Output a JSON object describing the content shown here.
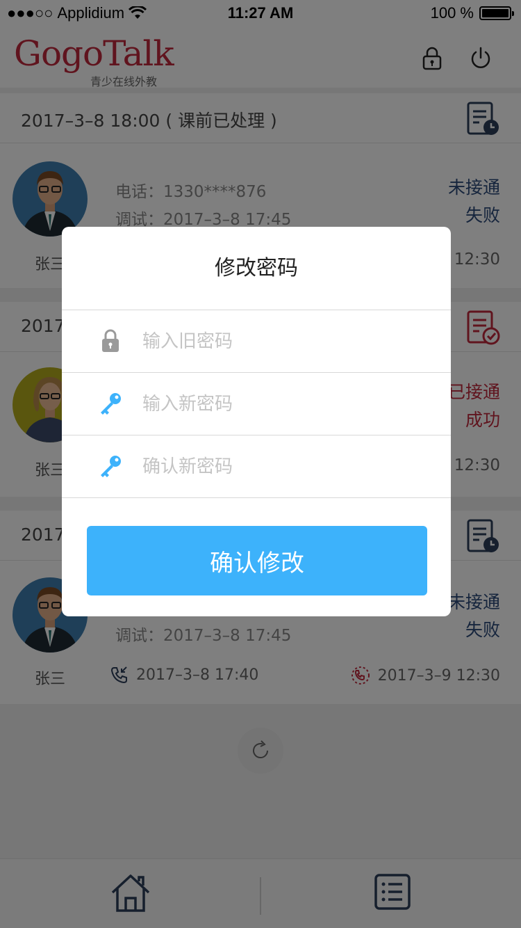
{
  "status_bar": {
    "signal": "●●●○○",
    "carrier": "Applidium",
    "time": "11:27 AM",
    "battery": "100 %"
  },
  "header": {
    "logo_text": "GogoTalk",
    "logo_sub": "青少在线外教",
    "icons": [
      "lock-icon",
      "power-icon"
    ]
  },
  "sessions": [
    {
      "date_line": "2017–3–8  18:00 ( 课前已处理 )",
      "calendar_icon": "calendar-clock-icon",
      "name": "张三",
      "phone": "电话：1330****876",
      "debug": "调试：2017–3–8   17:45",
      "status_line1": "未接通",
      "status_line2": "失败",
      "end_time": "12:30"
    },
    {
      "date_line": "2017",
      "calendar_icon": "calendar-check-icon",
      "name": "张三",
      "status_line1": "已接通",
      "status_line2": "成功",
      "end_time": "12:30"
    },
    {
      "date_line": "2017",
      "calendar_icon": "calendar-clock-icon",
      "name": "张三",
      "debug": "调试：2017–3–8   17:45",
      "status_line1": "未接通",
      "status_line2": "失败",
      "call_start": "2017–3–8  17:40",
      "call_end": "2017–3–9  12:30"
    }
  ],
  "tabbar": {
    "icons": [
      "home-icon",
      "list-icon"
    ]
  },
  "dialog": {
    "title": "修改密码",
    "old_password_placeholder": "输入旧密码",
    "new_password_placeholder": "输入新密码",
    "confirm_password_placeholder": "确认新密码",
    "confirm_button": "确认修改"
  },
  "colors": {
    "brand_red": "#c0283c",
    "accent_blue": "#3db2fb",
    "status_blue": "#2c4a7a",
    "overlay": "rgba(0,0,0,0.5)"
  }
}
